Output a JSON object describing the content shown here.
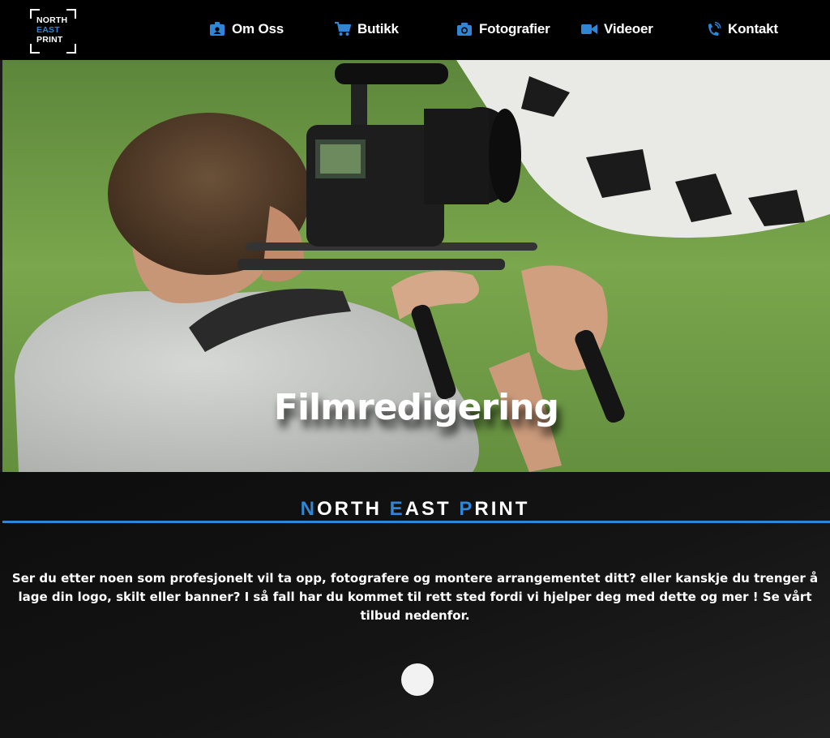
{
  "logo": {
    "line1": "NORTH",
    "line2": "EAST",
    "line3": "PRINT"
  },
  "nav": {
    "items": [
      {
        "label": "Om Oss",
        "icon": "id-badge-icon"
      },
      {
        "label": "Butikk",
        "icon": "cart-icon"
      },
      {
        "label": "Fotografier",
        "icon": "camera-icon"
      },
      {
        "label": "Videoer",
        "icon": "video-camera-icon"
      },
      {
        "label": "Kontakt",
        "icon": "phone-icon"
      }
    ]
  },
  "hero": {
    "title": "Filmredigering"
  },
  "section": {
    "brand": [
      {
        "initial": "N",
        "rest": "ORTH"
      },
      {
        "initial": "E",
        "rest": "AST"
      },
      {
        "initial": "P",
        "rest": "RINT"
      }
    ],
    "intro": "Ser du etter noen som profesjonelt vil ta opp, fotografere og montere arrangementet ditt? eller kanskje du trenger å lage din logo, skilt eller banner? I så fall har du kommet til rett sted fordi vi hjelper deg med dette og mer ! Se vårt tilbud nedenfor."
  },
  "colors": {
    "accent": "#2f86d6",
    "nav_bg": "#000000",
    "section_bg": "#141414"
  }
}
